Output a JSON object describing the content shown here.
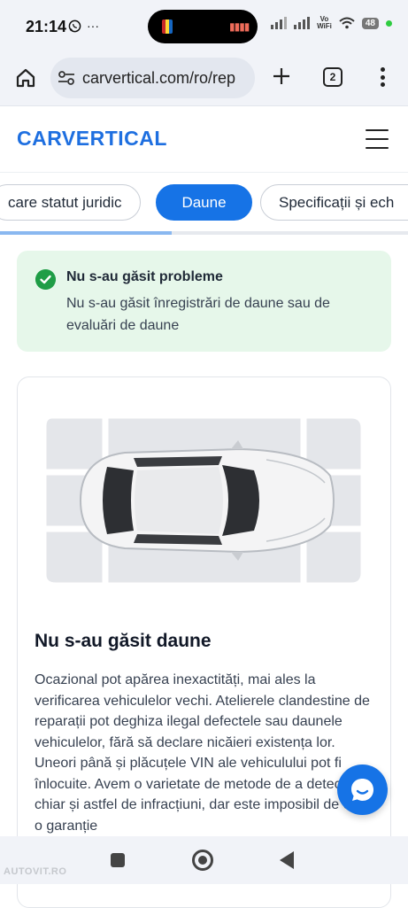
{
  "status_bar": {
    "time": "21:14",
    "left_icons": [
      "whatsapp-icon",
      "more-dots-icon"
    ],
    "left_extra": "···",
    "volte_top": "Vo",
    "volte_bottom": "WiFi",
    "battery": "48"
  },
  "browser": {
    "url": "carvertical.com/ro/rep",
    "tabs_count": "2"
  },
  "site": {
    "logo": "CARVERTICAL"
  },
  "tabs": [
    {
      "label": "care statut juridic",
      "active": false
    },
    {
      "label": "Daune",
      "active": true
    },
    {
      "label": "Specificații și ech",
      "active": false
    }
  ],
  "scroll_progress": 0.42,
  "alert": {
    "title": "Nu s-au găsit probleme",
    "text": "Nu s-au găsit înregistrări de daune sau de evaluări de daune"
  },
  "damage_card": {
    "title": "Nu s-au găsit daune",
    "text": "Ocazional pot apărea inexactități, mai ales la verificarea vehiculelor vechi. Atelierele clandestine de reparații pot deghiza ilegal defectele sau daunele vehiculelor, fără să declare nicăieri existența lor. Uneori până și plăcuțele VIN ale vehiculului pot fi înlocuite. Avem o varietate de metode de a detecta chiar și astfel de infracțiuni, dar este imposibil de oferit o garanție"
  },
  "watermark": "AUTOVIT.RO",
  "colors": {
    "brand_blue": "#1673e6",
    "alert_bg": "#e6f7ea",
    "check_green": "#1f9d46"
  }
}
